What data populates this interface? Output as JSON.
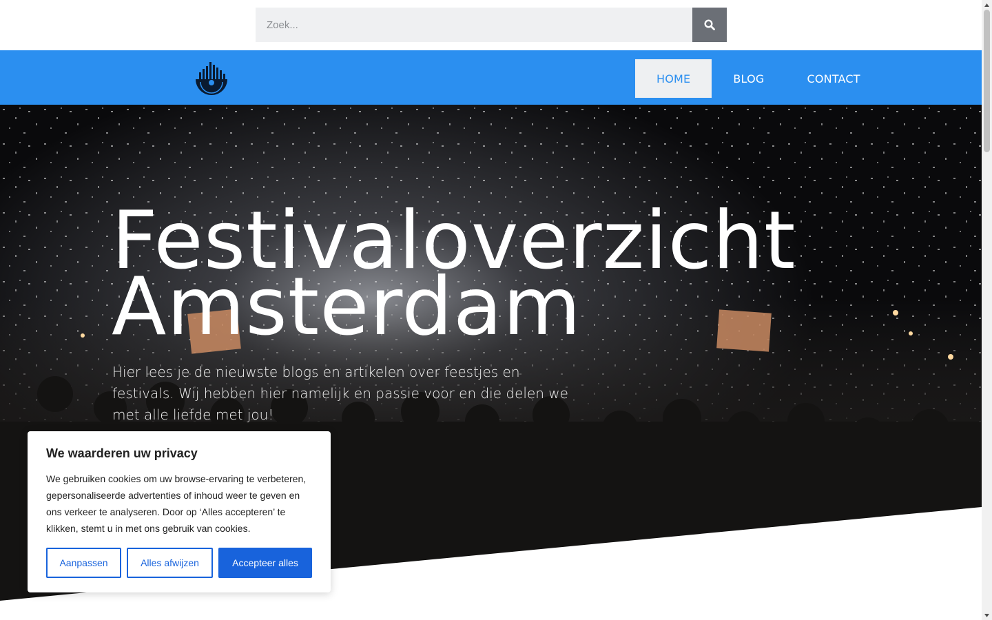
{
  "search": {
    "placeholder": "Zoek..."
  },
  "nav": {
    "items": [
      {
        "label": "HOME"
      },
      {
        "label": "BLOG"
      },
      {
        "label": "CONTACT"
      }
    ]
  },
  "hero": {
    "title_line1": "Festivaloverzicht",
    "title_line2": "Amsterdam",
    "subtitle": "Hier lees je de nieuwste blogs en artikelen over feestjes en festivals. Wij hebben hier namelijk en passie voor en die delen we met alle liefde met jou!"
  },
  "cookie": {
    "title": "We waarderen uw privacy",
    "text": "We gebruiken cookies om uw browse-ervaring te verbeteren, gepersonaliseerde advertenties of inhoud weer te geven en ons verkeer te analyseren. Door op ‘Alles accepteren’ te klikken, stemt u in met ons gebruik van cookies.",
    "customize_label": "Aanpassen",
    "reject_label": "Alles afwijzen",
    "accept_label": "Accepteer alles"
  },
  "colors": {
    "nav_bg": "#2b8ff0",
    "button_blue": "#1863dc",
    "search_button": "#6b6f76"
  },
  "icons": {
    "search": "search-icon",
    "logo": "vinyl-equalizer-logo-icon"
  }
}
